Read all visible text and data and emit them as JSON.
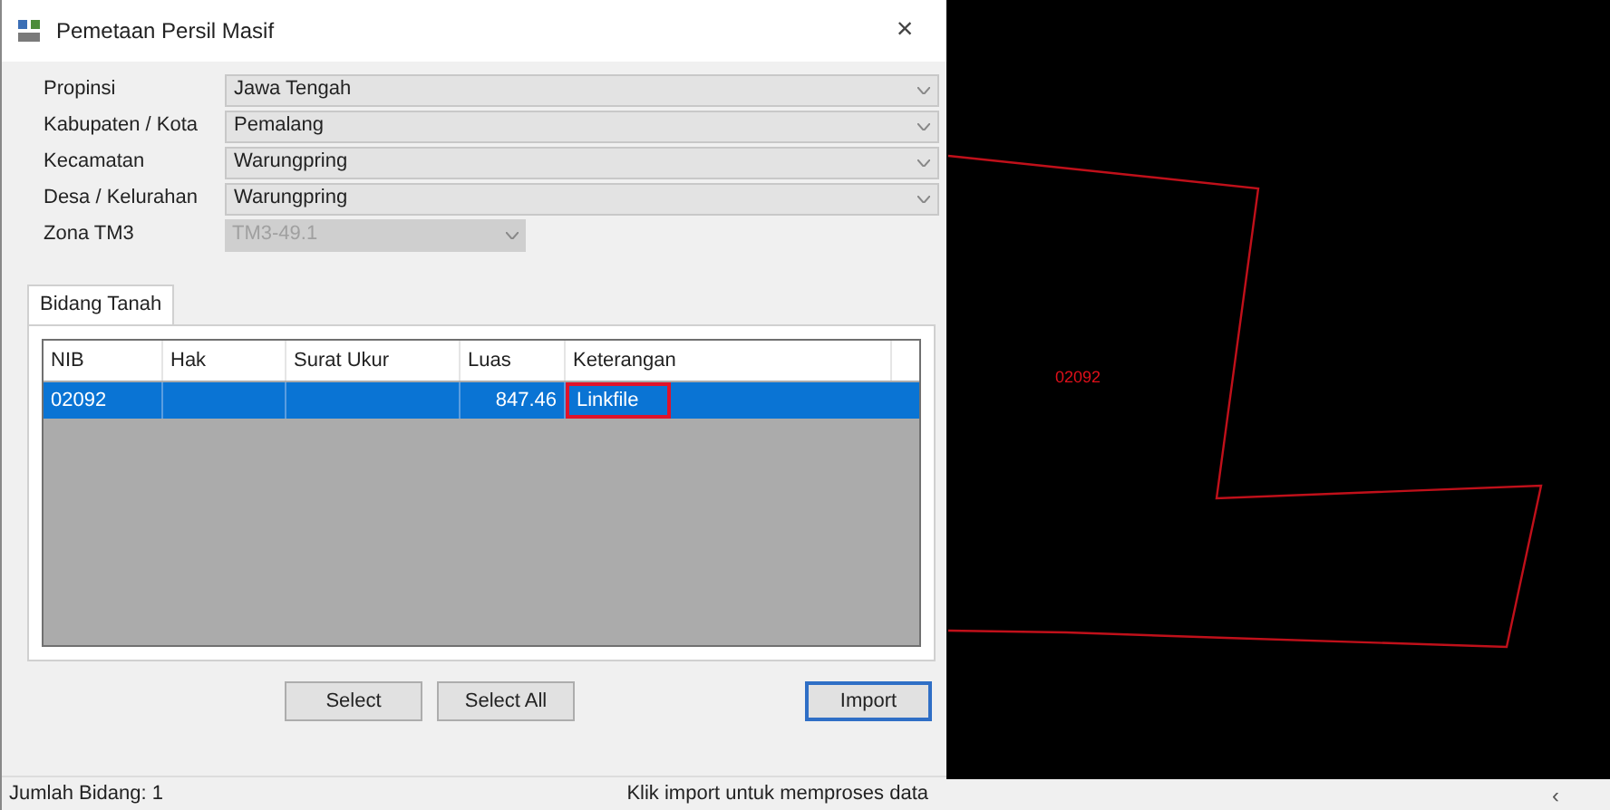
{
  "window": {
    "title": "Pemetaan Persil Masif",
    "close": "×"
  },
  "fields": [
    {
      "label": "Propinsi",
      "value": "Jawa Tengah",
      "disabled": false
    },
    {
      "label": "Kabupaten / Kota",
      "value": "Pemalang",
      "disabled": false
    },
    {
      "label": "Kecamatan",
      "value": "Warungpring",
      "disabled": false
    },
    {
      "label": "Desa / Kelurahan",
      "value": "Warungpring",
      "disabled": false
    },
    {
      "label": "Zona TM3",
      "value": "TM3-49.1",
      "disabled": true
    }
  ],
  "tabs": [
    {
      "label": "Bidang Tanah",
      "selected": true
    }
  ],
  "table": {
    "columns": [
      "NIB",
      "Hak",
      "Surat Ukur",
      "Luas",
      "Keterangan"
    ],
    "rows": [
      {
        "cells": [
          {
            "text": "02092",
            "highlighted": false
          },
          {
            "text": "",
            "highlighted": false
          },
          {
            "text": "",
            "highlighted": false
          },
          {
            "text": "847.46",
            "highlighted": false
          },
          {
            "text": "Linkfile",
            "highlighted": true
          }
        ],
        "selected": true
      }
    ]
  },
  "buttons": [
    {
      "label": "Select",
      "focused": false
    },
    {
      "label": "Select All",
      "focused": false
    },
    {
      "label": "Import",
      "focused": true
    }
  ],
  "status_bar": {
    "left": "Jumlah Bidang: 1",
    "right": "Klik import untuk memproses data"
  },
  "canvas": {
    "parcel_label": "02092",
    "scroll_arrow": "‹"
  }
}
